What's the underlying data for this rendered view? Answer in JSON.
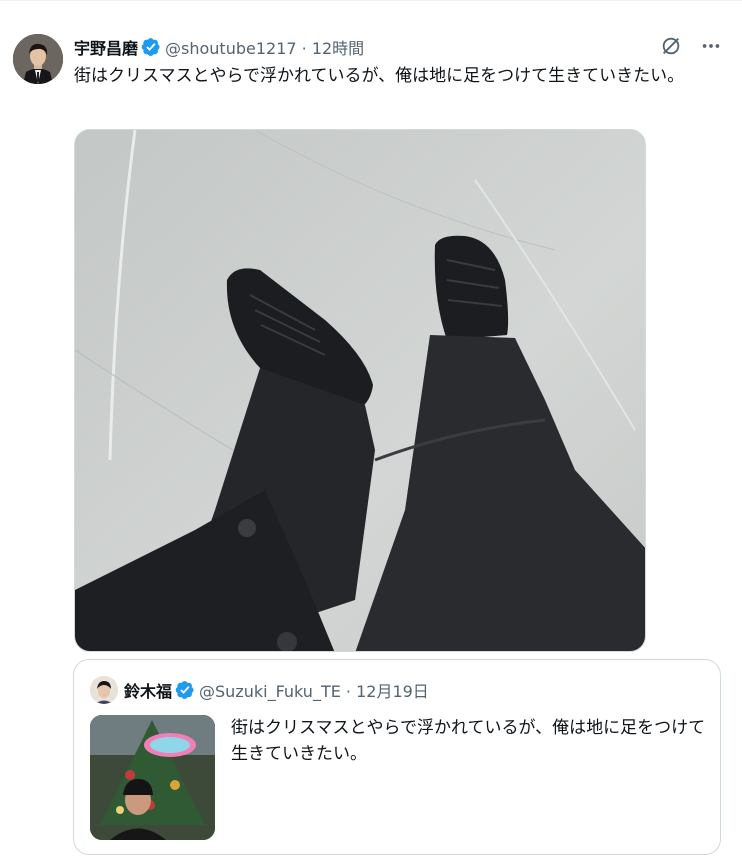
{
  "tweet": {
    "display_name": "宇野昌磨",
    "handle_time": "@shoutube1217 · 12時間",
    "text": "街はクリスマスとやらで浮かれているが、俺は地に足をつけて生きていきたい。"
  },
  "quote": {
    "display_name": "鈴木福",
    "handle_time": "@Suzuki_Fuku_TE · 12月19日",
    "text": "街はクリスマスとやらで浮かれているが、俺は地に足をつけて生きていきたい。"
  },
  "colors": {
    "verified": "#1d9bf0",
    "secondary_text": "#536471",
    "border": "#cfd9de"
  },
  "icons": [
    "verified-badge-icon",
    "grok-icon",
    "more-icon"
  ]
}
